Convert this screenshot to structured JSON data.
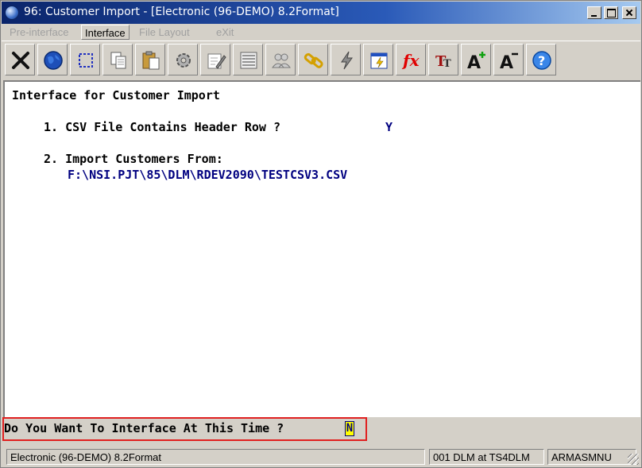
{
  "window": {
    "title": "96: Customer Import - [Electronic (96-DEMO) 8.2Format]"
  },
  "menu": {
    "items": [
      {
        "label": "Pre-interface",
        "active": false
      },
      {
        "label": "Interface",
        "active": true
      },
      {
        "label": "File Layout",
        "active": false
      },
      {
        "label": "eXit",
        "active": false
      }
    ]
  },
  "toolbar": {
    "icons": [
      "close-x-icon",
      "globe-icon",
      "select-area-icon",
      "copy-icon",
      "paste-icon",
      "settings-gear-icon",
      "edit-form-icon",
      "list-view-icon",
      "users-icon",
      "link-icon",
      "lightning-icon",
      "calendar-run-icon",
      "function-fx-icon",
      "font-type-icon",
      "font-increase-icon",
      "font-decrease-icon",
      "help-icon"
    ]
  },
  "content": {
    "heading": "Interface for Customer Import",
    "q1_label": "1. CSV File Contains Header Row ?",
    "q1_value": "Y",
    "q2_label": "2. Import Customers From:",
    "q2_value": "F:\\NSI.PJT\\85\\DLM\\RDEV2090\\TESTCSV3.CSV"
  },
  "prompt": {
    "text": "Do You Want To Interface At This Time ?",
    "value": "N"
  },
  "status": {
    "left": "Electronic (96-DEMO) 8.2Format",
    "middle": "001 DLM at TS4DLM",
    "right": "ARMASMNU"
  },
  "colors": {
    "title_bar": "#0a246a",
    "highlight_box": "#e02020",
    "input_bg": "#ffff00",
    "field_text": "#000080"
  }
}
